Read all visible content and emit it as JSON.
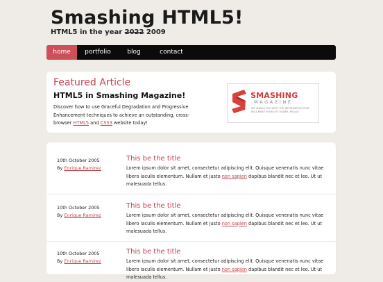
{
  "header": {
    "title": "Smashing HTML5!",
    "tagline_prefix": "HTML5 in the year ",
    "tagline_struck": "2022",
    "tagline_suffix": " 2009"
  },
  "nav": {
    "items": [
      {
        "label": "home"
      },
      {
        "label": "portfolio"
      },
      {
        "label": "blog"
      },
      {
        "label": "contact"
      }
    ]
  },
  "featured": {
    "heading": "Featured Article",
    "subtitle": "HTML5 in Smashing Magazine!",
    "body_before": "Discover how to use Graceful Degradation and Progressive Enhancement techniques to achieve an outstanding, cross-browser ",
    "link1": "HTML5",
    "body_mid": " and ",
    "link2": "CSS3",
    "body_after": " website today!",
    "logo": {
      "word": "SMASHING",
      "mag": "MAGAZINE",
      "tagline": "WE SMASH YOU WITH THE INFORMATION THAT WILL MAKE YOUR LIFE EASIER. REALLY."
    }
  },
  "posts": [
    {
      "date": "10th October 2005",
      "by": "By ",
      "author": "Enrique Ramírez",
      "title": "This be the title",
      "text_before": "Lorem ipsum dolor sit amet, consectetur adipiscing elit. Quisque venenatis nunc vitae libero iaculis elementum. Nullam et justo ",
      "link": "non sapien",
      "text_after": " dapibus blandit nec et leo. Ut ut malesuada tellus."
    },
    {
      "date": "10th October 2005",
      "by": "By ",
      "author": "Enrique Ramírez",
      "title": "This be the title",
      "text_before": "Lorem ipsum dolor sit amet, consectetur adipiscing elit. Quisque venenatis nunc vitae libero iaculis elementum. Nullam et justo ",
      "link": "non sapien",
      "text_after": " dapibus blandit nec et leo. Ut ut malesuada tellus."
    },
    {
      "date": "10th October 2005",
      "by": "By ",
      "author": "Enrique Ramírez",
      "title": "This be the title",
      "text_before": "Lorem ipsum dolor sit amet, consectetur adipiscing elit. Quisque venenatis nunc vitae libero iaculis elementum. Nullam et justo ",
      "link": "non sapien",
      "text_after": " dapibus blandit nec et leo. Ut ut malesuada tellus."
    }
  ],
  "colors": {
    "accent": "#c2454f",
    "nav_active": "#cd4f5a",
    "nav_bg": "#0b0b0b",
    "page_bg": "#efece7"
  }
}
